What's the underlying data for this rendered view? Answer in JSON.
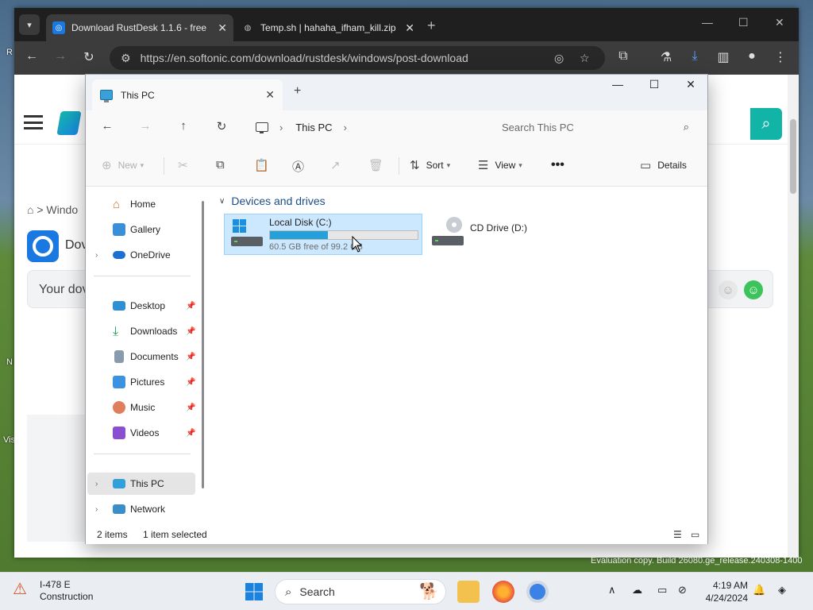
{
  "desktop": {
    "labels": [
      "R",
      "N",
      "Vis"
    ],
    "evaluation_text": "Evaluation copy. Build 26080.ge_release.240308-1400"
  },
  "browser": {
    "tabs": [
      {
        "title": "Download RustDesk 1.1.6 - free",
        "favicon": "softonic-icon",
        "active": true
      },
      {
        "title": "Temp.sh | hahaha_ifham_kill.zip",
        "favicon": "globe-icon",
        "active": false
      }
    ],
    "url": "https://en.softonic.com/download/rustdesk/windows/post-download"
  },
  "page": {
    "breadcrumb": "> Windo",
    "app_name": "Dov",
    "banner_text": "Your dov"
  },
  "explorer": {
    "tab_title": "This PC",
    "address": "This PC",
    "search_placeholder": "Search This PC",
    "commands": {
      "new": "New",
      "sort": "Sort",
      "view": "View",
      "details": "Details"
    },
    "nav": {
      "home": "Home",
      "gallery": "Gallery",
      "onedrive": "OneDrive",
      "desktop": "Desktop",
      "downloads": "Downloads",
      "documents": "Documents",
      "pictures": "Pictures",
      "music": "Music",
      "videos": "Videos",
      "this_pc": "This PC",
      "network": "Network"
    },
    "group_title": "Devices and drives",
    "drives": [
      {
        "name": "Local Disk (C:)",
        "free_text": "60.5 GB free of 99.2 GB",
        "used_fraction": 0.39,
        "selected": true
      },
      {
        "name": "CD Drive (D:)",
        "selected": false
      }
    ],
    "status": {
      "items": "2 items",
      "selected": "1 item selected"
    }
  },
  "taskbar": {
    "weather_title": "I-478 E",
    "weather_sub": "Construction",
    "search_label": "Search",
    "time": "4:19 AM",
    "date": "4/24/2024"
  }
}
